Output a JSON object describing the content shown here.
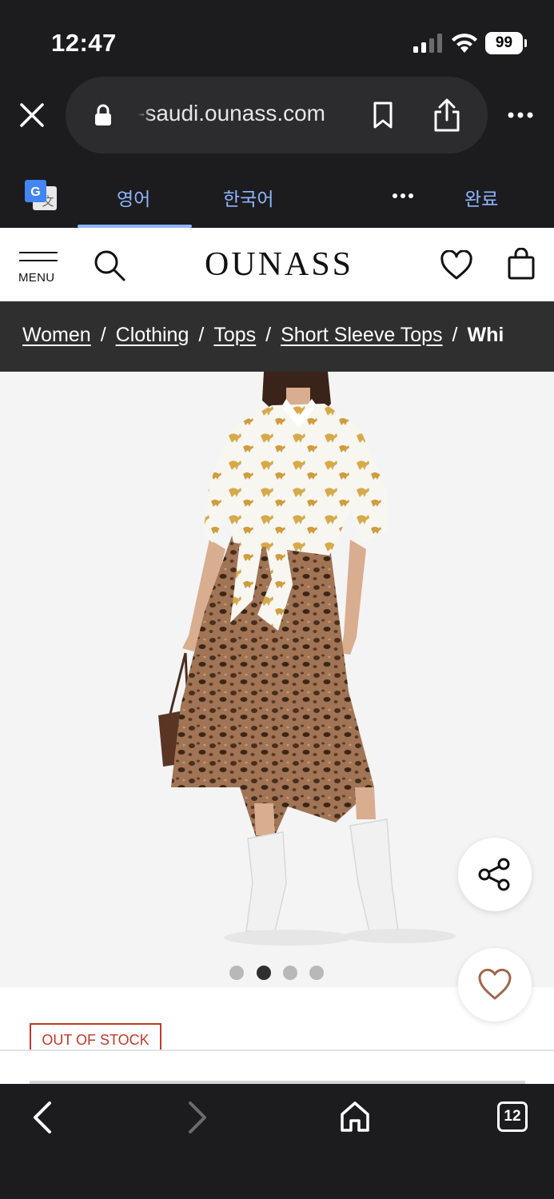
{
  "status_bar": {
    "time": "12:47",
    "battery": "99"
  },
  "browser": {
    "url_display": "-saudi.ounass.com"
  },
  "translate_bar": {
    "source_lang": "영어",
    "target_lang": "한국어",
    "done_label": "완료"
  },
  "site_header": {
    "menu_label": "MENU",
    "logo": "OUNASS"
  },
  "breadcrumb": {
    "items": [
      "Women",
      "Clothing",
      "Tops",
      "Short Sleeve Tops"
    ],
    "current": "Whi",
    "separator": "/"
  },
  "gallery": {
    "slide_count": 4,
    "active_index": 1
  },
  "product": {
    "stock_badge": "OUT OF STOCK"
  },
  "bottom_nav": {
    "tab_count": "12"
  },
  "colors": {
    "accent_blue": "#8fb6ff",
    "stock_red": "#c0392b",
    "chrome_dark": "#1c1c1e",
    "breadcrumb_bg": "#2f2f2f"
  }
}
